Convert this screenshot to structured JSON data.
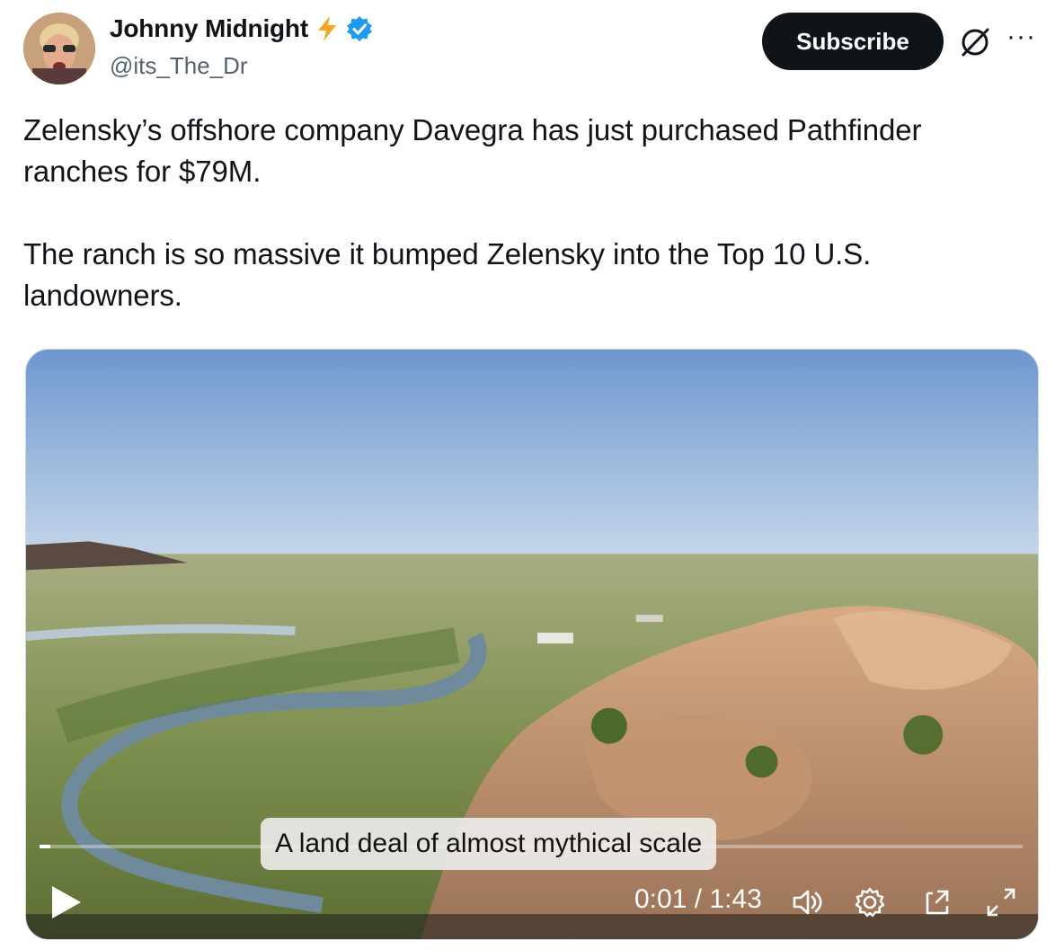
{
  "author": {
    "display_name": "Johnny Midnight",
    "handle": "@its_The_Dr",
    "emoji": "⚡"
  },
  "header": {
    "subscribe_label": "Subscribe",
    "more_label": "···"
  },
  "tweet": {
    "text": "Zelensky’s offshore company Davegra has just purchased Pathfinder ranches for $79M.\n\nThe ranch is so massive it bumped Zelensky into the Top 10 U.S. landowners."
  },
  "video": {
    "caption": "A land deal of almost mythical scale",
    "time": "0:01 / 1:43",
    "progress_fraction": 0.011
  },
  "colors": {
    "verified": "#1d9bf0",
    "bolt": "#f5a623"
  }
}
